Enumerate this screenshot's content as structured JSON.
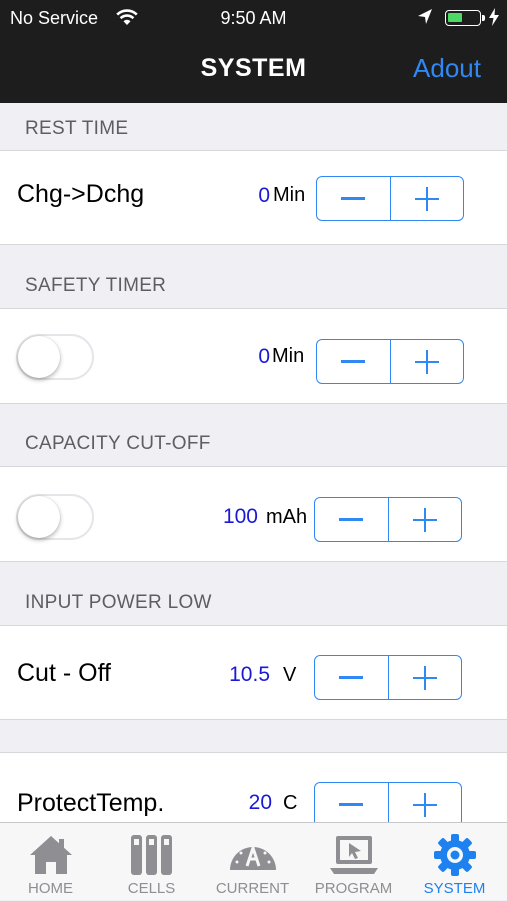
{
  "status_bar": {
    "carrier": "No Service",
    "time": "9:50 AM"
  },
  "nav": {
    "title": "SYSTEM",
    "right_button": "Adout"
  },
  "sections": {
    "rest_time": {
      "header": "REST TIME",
      "label": "Chg->Dchg",
      "value": "0",
      "unit": "Min"
    },
    "safety_timer": {
      "header": "SAFETY TIMER",
      "enabled": false,
      "value": "0",
      "unit": "Min"
    },
    "capacity_cutoff": {
      "header": "CAPACITY CUT-OFF",
      "enabled": false,
      "value": "100",
      "unit": "mAh"
    },
    "input_power_low": {
      "header": "INPUT POWER LOW",
      "label": "Cut - Off",
      "value": "10.5",
      "unit": "V"
    },
    "protect_temp": {
      "label": "ProtectTemp.",
      "value": "20",
      "unit": "C"
    }
  },
  "tabs": [
    {
      "label": "HOME",
      "icon": "home-icon",
      "active": false
    },
    {
      "label": "CELLS",
      "icon": "cells-icon",
      "active": false
    },
    {
      "label": "CURRENT",
      "icon": "gauge-icon",
      "active": false
    },
    {
      "label": "PROGRAM",
      "icon": "laptop-icon",
      "active": false
    },
    {
      "label": "SYSTEM",
      "icon": "gear-icon",
      "active": true
    }
  ],
  "colors": {
    "accent": "#2f88f4",
    "value_blue": "#1a1ad6",
    "nav_bg": "#1d1d1d",
    "tab_active": "#1d82f0",
    "tab_inactive": "#8e8e93"
  }
}
